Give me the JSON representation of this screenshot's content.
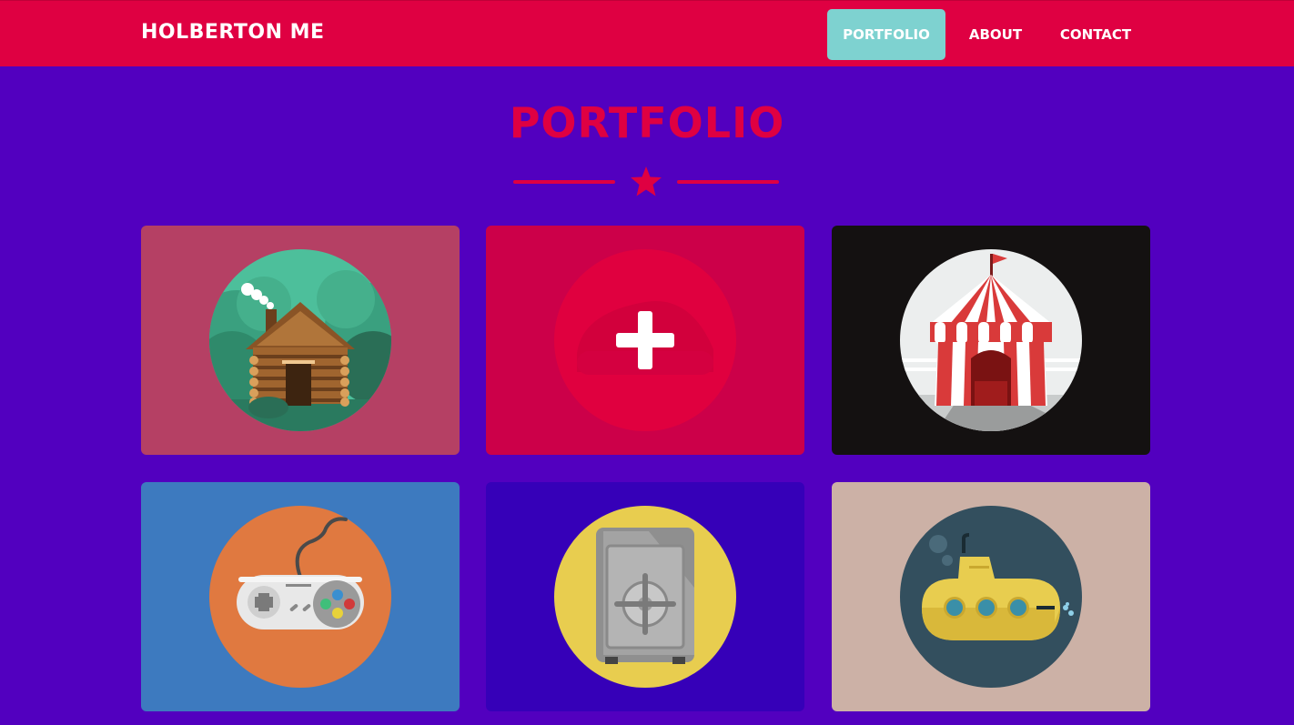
{
  "navbar": {
    "brand": "HOLBERTON ME",
    "links": [
      "PORTFOLIO",
      "ABOUT",
      "CONTACT"
    ],
    "active_index": 0
  },
  "colors": {
    "background": "#5200bf",
    "navbar": "#df0042",
    "accent": "#df0042",
    "active_link": "#7ed2d0"
  },
  "section": {
    "title": "PORTFOLIO",
    "divider_icon": "star-icon"
  },
  "portfolio_items": [
    {
      "icon": "log-cabin-icon",
      "background": "#b54064"
    },
    {
      "icon": "plus-icon",
      "background": "#cc0049",
      "hovered": true
    },
    {
      "icon": "circus-tent-icon",
      "background": "#141111"
    },
    {
      "icon": "game-controller-icon",
      "background": "#3d7abf"
    },
    {
      "icon": "safe-icon",
      "background": "#3600b8"
    },
    {
      "icon": "submarine-icon",
      "background": "#ccb1a6"
    }
  ]
}
